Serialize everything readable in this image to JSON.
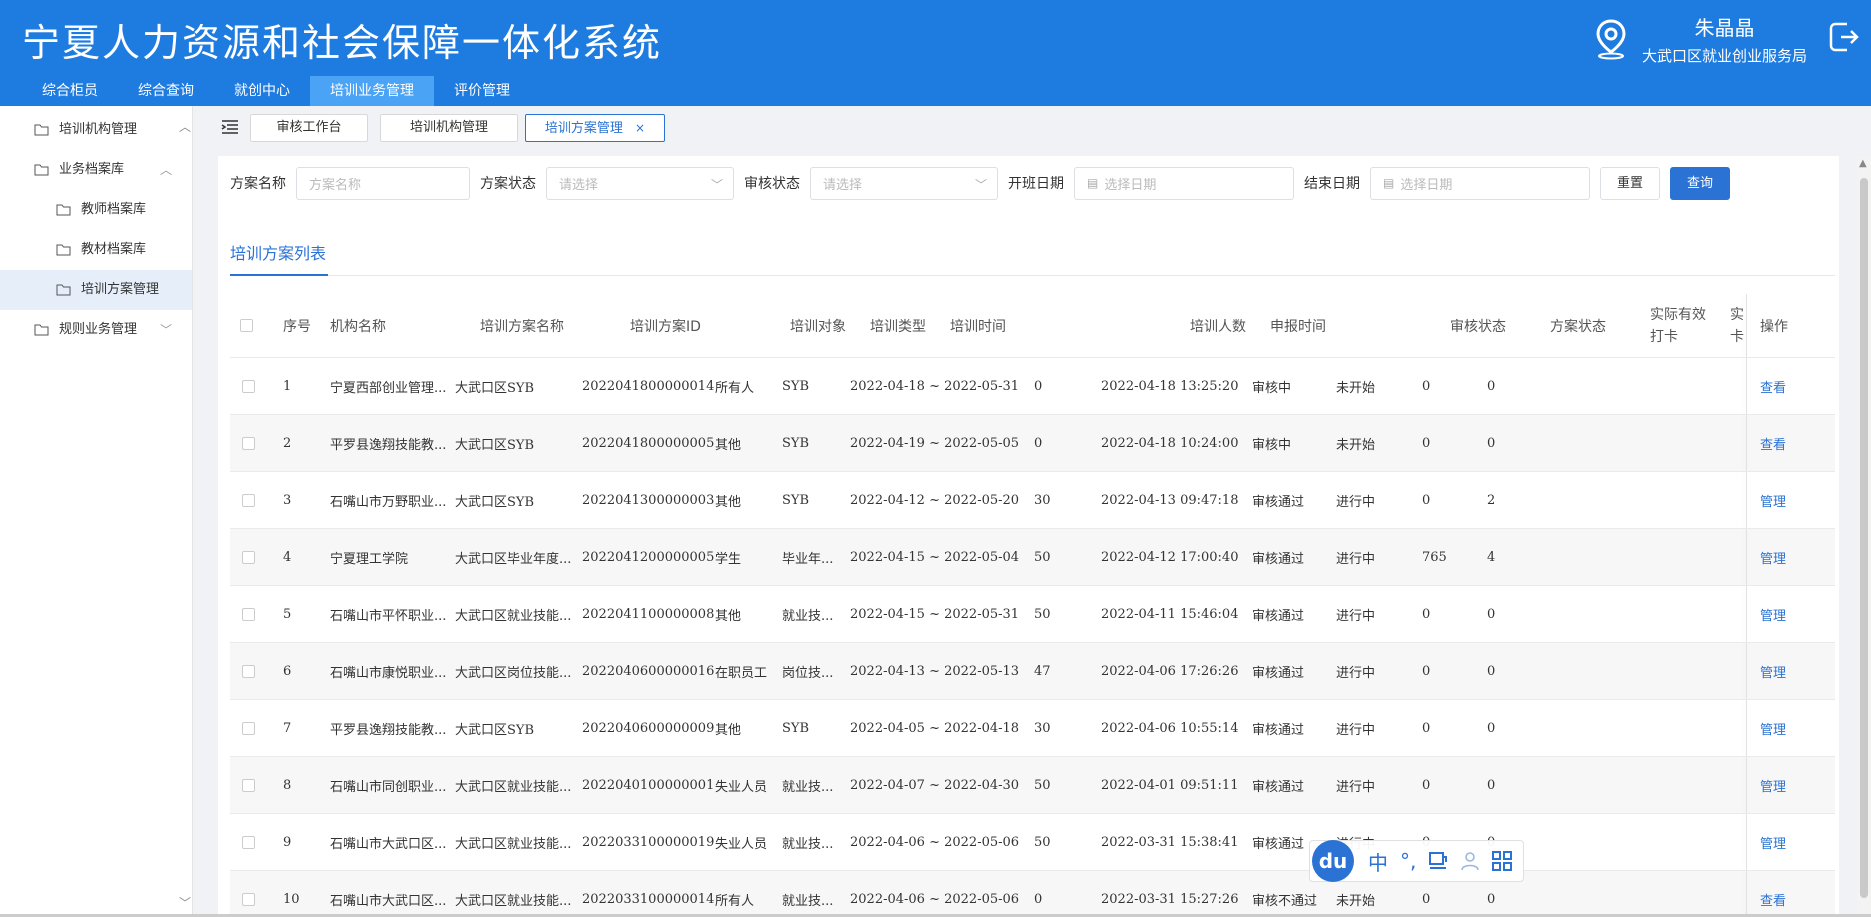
{
  "app": {
    "title": "宁夏人力资源和社会保障一体化系统",
    "user_name": "朱晶晶",
    "user_org": "大武口区就业创业服务局"
  },
  "top_nav": [
    {
      "label": "综合柜员",
      "active": false
    },
    {
      "label": "综合查询",
      "active": false
    },
    {
      "label": "就创中心",
      "active": false
    },
    {
      "label": "培训业务管理",
      "active": true
    },
    {
      "label": "评价管理",
      "active": false
    }
  ],
  "sidebar": {
    "items": [
      {
        "label": "培训机构管理",
        "level": 1,
        "chevron": ""
      },
      {
        "label": "业务档案库",
        "level": 1,
        "chevron": "︿"
      },
      {
        "label": "教师档案库",
        "level": 2,
        "chevron": ""
      },
      {
        "label": "教材档案库",
        "level": 2,
        "chevron": ""
      },
      {
        "label": "培训方案管理",
        "level": 2,
        "chevron": "",
        "active": true
      },
      {
        "label": "规则业务管理",
        "level": 1,
        "chevron": "﹀"
      }
    ]
  },
  "tabs": [
    {
      "label": "审核工作台"
    },
    {
      "label": "培训机构管理"
    },
    {
      "label": "培训方案管理",
      "active": true,
      "close": "×"
    }
  ],
  "filters": {
    "plan_name_label": "方案名称",
    "plan_name_placeholder": "方案名称",
    "plan_status_label": "方案状态",
    "plan_status_placeholder": "请选择",
    "audit_status_label": "审核状态",
    "audit_status_placeholder": "请选择",
    "start_date_label": "开班日期",
    "start_date_placeholder": "选择日期",
    "end_date_label": "结束日期",
    "end_date_placeholder": "选择日期",
    "reset_label": "重置",
    "query_label": "查询"
  },
  "list_tab": "培训方案列表",
  "table": {
    "headers": {
      "seq": "序号",
      "org": "机构名称",
      "plan_name": "培训方案名称",
      "plan_id": "培训方案ID",
      "target": "培训对象",
      "type": "培训类型",
      "time": "培训时间",
      "count": "培训人数",
      "report_time": "申报时间",
      "audit": "审核状态",
      "status": "方案状态",
      "checkin_1": "实际有效",
      "checkin_2": "打卡",
      "extra_1": "实",
      "extra_2": "卡",
      "op": "操作"
    },
    "rows": [
      {
        "seq": "1",
        "org": "宁夏西部创业管理...",
        "plan_name": "大武口区SYB",
        "plan_id": "2022041800000014",
        "target": "所有人",
        "type": "SYB",
        "time": "2022-04-18 ~ 2022-05-31",
        "count": "0",
        "report_time": "2022-04-18 13:25:20",
        "audit": "审核中",
        "status": "未开始",
        "checkin": "0",
        "extra": "0",
        "op": "查看"
      },
      {
        "seq": "2",
        "org": "平罗县逸翔技能教...",
        "plan_name": "大武口区SYB",
        "plan_id": "2022041800000005",
        "target": "其他",
        "type": "SYB",
        "time": "2022-04-19 ~ 2022-05-05",
        "count": "0",
        "report_time": "2022-04-18 10:24:00",
        "audit": "审核中",
        "status": "未开始",
        "checkin": "0",
        "extra": "0",
        "op": "查看"
      },
      {
        "seq": "3",
        "org": "石嘴山市万野职业...",
        "plan_name": "大武口区SYB",
        "plan_id": "2022041300000003",
        "target": "其他",
        "type": "SYB",
        "time": "2022-04-12 ~ 2022-05-20",
        "count": "30",
        "report_time": "2022-04-13 09:47:18",
        "audit": "审核通过",
        "status": "进行中",
        "checkin": "0",
        "extra": "2",
        "op": "管理"
      },
      {
        "seq": "4",
        "org": "宁夏理工学院",
        "plan_name": "大武口区毕业年度...",
        "plan_id": "2022041200000005",
        "target": "学生",
        "type": "毕业年...",
        "time": "2022-04-15 ~ 2022-05-04",
        "count": "50",
        "report_time": "2022-04-12 17:00:40",
        "audit": "审核通过",
        "status": "进行中",
        "checkin": "765",
        "extra": "4",
        "op": "管理"
      },
      {
        "seq": "5",
        "org": "石嘴山市平怀职业...",
        "plan_name": "大武口区就业技能...",
        "plan_id": "2022041100000008",
        "target": "其他",
        "type": "就业技...",
        "time": "2022-04-15 ~ 2022-05-31",
        "count": "50",
        "report_time": "2022-04-11 15:46:04",
        "audit": "审核通过",
        "status": "进行中",
        "checkin": "0",
        "extra": "0",
        "op": "管理"
      },
      {
        "seq": "6",
        "org": "石嘴山市康悦职业...",
        "plan_name": "大武口区岗位技能...",
        "plan_id": "2022040600000016",
        "target": "在职员工",
        "type": "岗位技...",
        "time": "2022-04-13 ~ 2022-05-13",
        "count": "47",
        "report_time": "2022-04-06 17:26:26",
        "audit": "审核通过",
        "status": "进行中",
        "checkin": "0",
        "extra": "0",
        "op": "管理"
      },
      {
        "seq": "7",
        "org": "平罗县逸翔技能教...",
        "plan_name": "大武口区SYB",
        "plan_id": "2022040600000009",
        "target": "其他",
        "type": "SYB",
        "time": "2022-04-05 ~ 2022-04-18",
        "count": "30",
        "report_time": "2022-04-06 10:55:14",
        "audit": "审核通过",
        "status": "进行中",
        "checkin": "0",
        "extra": "0",
        "op": "管理"
      },
      {
        "seq": "8",
        "org": "石嘴山市同创职业...",
        "plan_name": "大武口区就业技能...",
        "plan_id": "2022040100000001",
        "target": "失业人员",
        "type": "就业技...",
        "time": "2022-04-07 ~ 2022-04-30",
        "count": "50",
        "report_time": "2022-04-01 09:51:11",
        "audit": "审核通过",
        "status": "进行中",
        "checkin": "0",
        "extra": "0",
        "op": "管理"
      },
      {
        "seq": "9",
        "org": "石嘴山市大武口区...",
        "plan_name": "大武口区就业技能...",
        "plan_id": "2022033100000019",
        "target": "失业人员",
        "type": "就业技...",
        "time": "2022-04-06 ~ 2022-05-06",
        "count": "50",
        "report_time": "2022-03-31 15:38:41",
        "audit": "审核通过",
        "status": "进行中",
        "checkin": "0",
        "extra": "0",
        "op": "管理"
      },
      {
        "seq": "10",
        "org": "石嘴山市大武口区...",
        "plan_name": "大武口区就业技能...",
        "plan_id": "2022033100000014",
        "target": "所有人",
        "type": "就业技...",
        "time": "2022-04-06 ~ 2022-05-06",
        "count": "0",
        "report_time": "2022-03-31 15:27:26",
        "audit": "审核不通过",
        "status": "未开始",
        "checkin": "0",
        "extra": "0",
        "op": "查看"
      }
    ]
  },
  "ime": {
    "logo": "du",
    "lang": "中",
    "punct": "°,",
    "icons": [
      "keyboard-icon",
      "user-icon",
      "grid-icon"
    ]
  },
  "colors": {
    "header": "#1e7be0",
    "accent": "#2a72d4",
    "nav_active": "#4aa3f5"
  }
}
